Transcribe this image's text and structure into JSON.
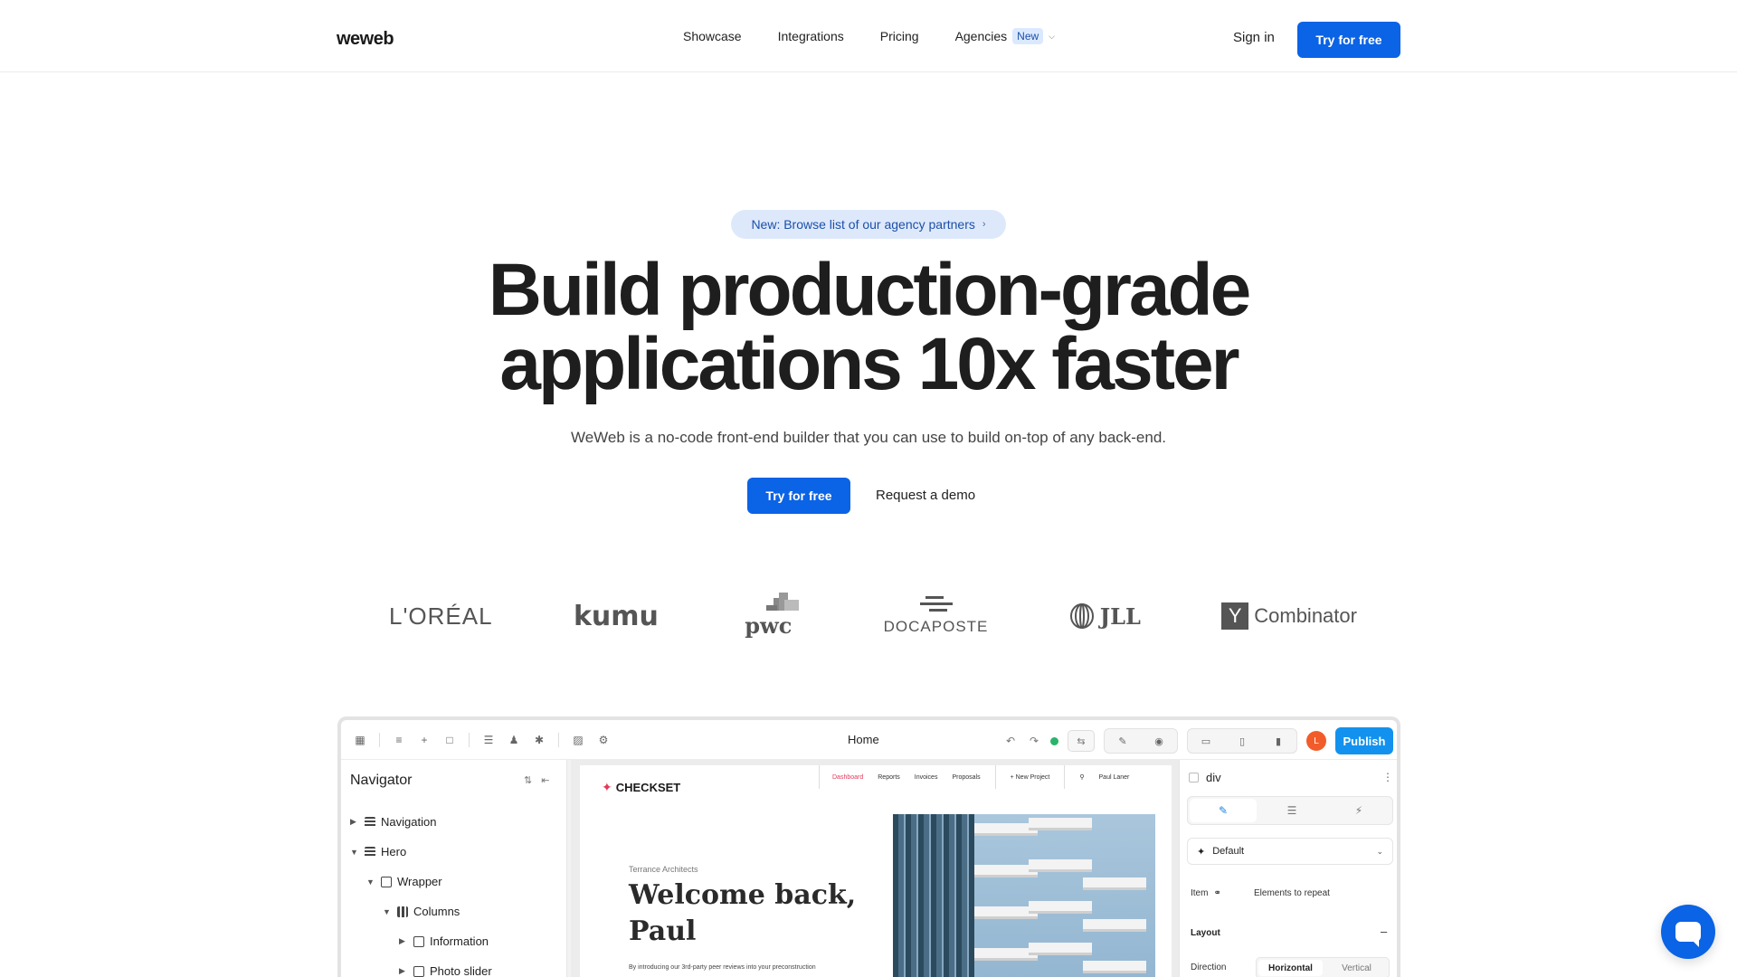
{
  "nav": {
    "logo": "weweb",
    "links": [
      "Showcase",
      "Integrations",
      "Pricing"
    ],
    "agencies": "Agencies",
    "agencies_badge": "New",
    "sign_in": "Sign in",
    "cta": "Try for free"
  },
  "hero": {
    "pill": "New: Browse list of our agency partners",
    "headline_line1": "Build production-grade",
    "headline_line2": "applications 10x faster",
    "subtitle": "WeWeb is a no-code front-end builder that you can use to build on-top of any back-end.",
    "cta_primary": "Try for free",
    "cta_secondary": "Request a demo"
  },
  "logos": {
    "loreal": "L'ORÉAL",
    "kumu": "kumu",
    "pwc": "pwc",
    "docaposte": "DOCAPOSTE",
    "jll": "JLL",
    "yc_mark": "Y",
    "yc_text": "Combinator"
  },
  "editor": {
    "page_name": "Home",
    "avatar_initial": "L",
    "publish": "Publish",
    "navigator": {
      "title": "Navigator",
      "items": [
        "Navigation",
        "Hero",
        "Wrapper",
        "Columns",
        "Information",
        "Photo slider"
      ]
    },
    "canvas": {
      "brand": "CHECKSET",
      "menu": [
        "Dashboard",
        "Reports",
        "Invoices",
        "Proposals"
      ],
      "new_project": "+ New Project",
      "user": "Paul Laner",
      "kicker": "Terrance Architects",
      "welcome_line1": "Welcome back,",
      "welcome_line2": "Paul",
      "intro": "By introducing our 3rd-party peer reviews into your preconstruction"
    },
    "properties": {
      "element": "div",
      "state": "Default",
      "item_label": "Item",
      "item_value": "Elements to repeat",
      "layout_label": "Layout",
      "direction_label": "Direction",
      "direction_options": [
        "Horizontal",
        "Vertical"
      ]
    }
  },
  "colors": {
    "primary": "#0b63e5",
    "publish": "#1292ee",
    "accent_red": "#e23a5a"
  }
}
